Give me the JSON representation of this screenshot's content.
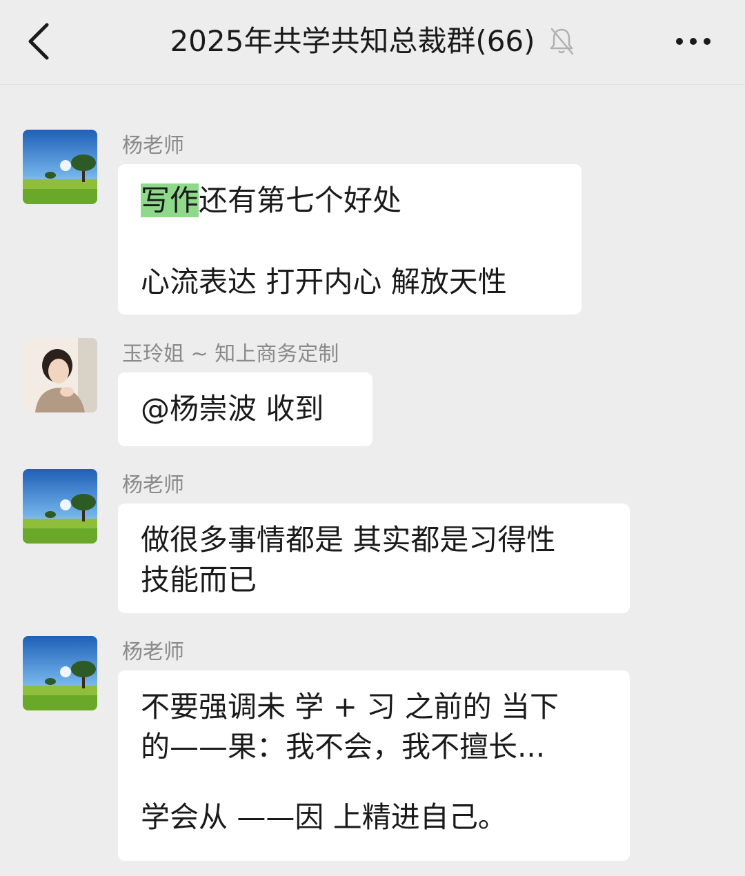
{
  "header": {
    "title": "2025年共学共知总裁群(66)",
    "back_icon": "chevron-left-icon",
    "mute_icon": "bell-off-icon",
    "more_icon": "more-dots-icon"
  },
  "messages": [
    {
      "sender": "杨老师",
      "avatar": "landscape-tree-avatar",
      "highlight": "写作",
      "line1_rest": "还有第七个好处",
      "line2": "心流表达  打开内心  解放天性"
    },
    {
      "sender": "玉玲姐 ~ 知上商务定制",
      "avatar": "woman-portrait-avatar",
      "text": "@杨崇波  收到"
    },
    {
      "sender": "杨老师",
      "avatar": "landscape-tree-avatar",
      "line1": "做很多事情都是 其实都是习得性",
      "line2": "技能而已"
    },
    {
      "sender": "杨老师",
      "avatar": "landscape-tree-avatar",
      "line1": "不要强调未  学 + 习  之前的 当下",
      "line2": "的——果：我不会，我不擅长...",
      "line3": "学会从 ——因  上精进自己。"
    }
  ],
  "colors": {
    "background": "#ededed",
    "bubble": "#ffffff",
    "highlight": "#8fd98b",
    "sender_text": "#8a8a8a"
  }
}
